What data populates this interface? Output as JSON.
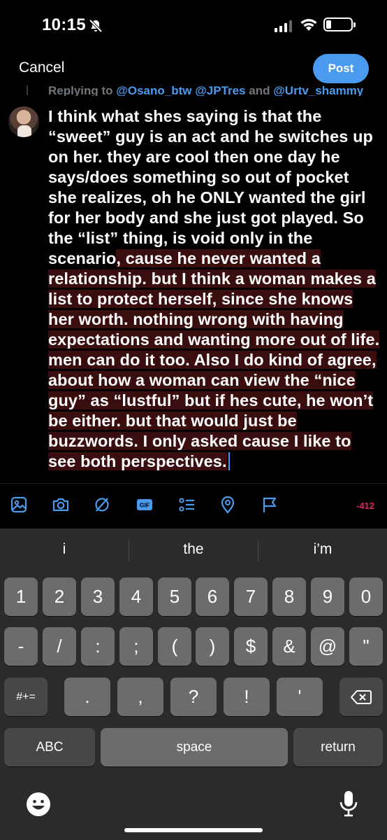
{
  "status": {
    "time": "10:15",
    "icons": [
      "bell-slash-icon",
      "cellular-signal-icon",
      "wifi-icon",
      "battery-icon"
    ]
  },
  "header": {
    "cancel_label": "Cancel",
    "post_label": "Post"
  },
  "compose": {
    "reply_prefix": "Replying to ",
    "mentions": [
      "@Osano_btw",
      "@JPTres",
      "@Urtv_shammy"
    ],
    "mention_join": " and ",
    "text_within_limit": "I think what shes saying is that the “sweet” guy is an act and he switches up on her. they are cool then one day he says/does something so out of pocket she realizes, oh he ONLY wanted the girl for her body and she just got played. So the “list” thing, is void only in the scenario",
    "text_over_limit": ", cause he never wanted a relationship. but I think a woman makes a list to protect herself, since she knows her worth. nothing wrong with having expectations and wanting more out of life. men can do it too. Also I do kind of agree, about how a woman can view the “nice guy” as “lustful” but if hes cute, he won’t be either. but that would just be buzzwords. I only asked cause I like to see both perspectives.",
    "char_count": "-412"
  },
  "toolbar": {
    "icons": [
      "image-icon",
      "camera-icon",
      "gif-icon",
      "poll-icon",
      "location-icon",
      "flag-icon"
    ],
    "gif_label": "GIF"
  },
  "keyboard": {
    "suggestions": [
      "i",
      "the",
      "i’m"
    ],
    "row1": [
      "1",
      "2",
      "3",
      "4",
      "5",
      "6",
      "7",
      "8",
      "9",
      "0"
    ],
    "row2": [
      "-",
      "/",
      ":",
      ";",
      "(",
      ")",
      "$",
      "&",
      "@",
      "\""
    ],
    "row3_left": "#+=",
    "row3": [
      ".",
      ",",
      "?",
      "!",
      "'"
    ],
    "abc_label": "ABC",
    "space_label": "space",
    "return_label": "return"
  },
  "colors": {
    "accent": "#4a9bf0",
    "overflow_highlight": "#3a0d0f",
    "count_red": "#e0245e"
  }
}
